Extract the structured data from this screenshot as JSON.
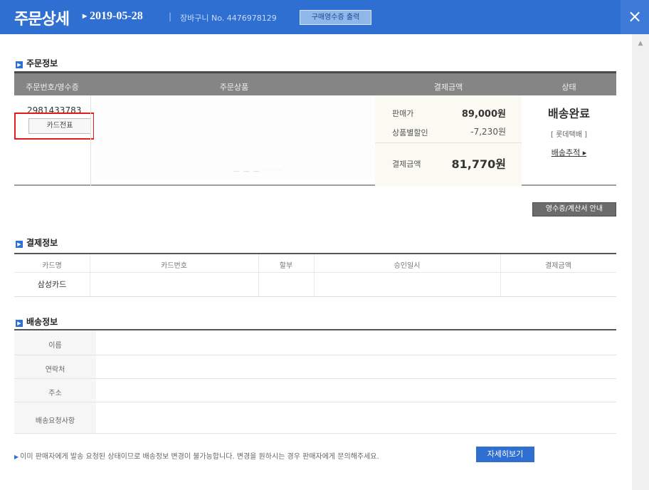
{
  "header": {
    "title": "주문상세",
    "date": "2019-05-28",
    "separator": "|",
    "cart_no": "장바구니 No. 4476978129",
    "print_button": "구매영수증 출력",
    "close_icon": "×"
  },
  "order_info": {
    "section_title": "주문정보",
    "columns": [
      "주문번호/영수증",
      "주문상품",
      "결제금액",
      "상태"
    ],
    "order_number": "2981433783",
    "card_slip_button": "카드전표",
    "payment": {
      "price_label": "판매가",
      "price_value": "89,000원",
      "discount_label": "상품별할인",
      "discount_value": "-7,230원",
      "total_label": "결제금액",
      "total_value": "81,770원"
    },
    "status": {
      "main": "배송완료",
      "courier": "[ 롯데택배 ]",
      "tracking_link": "배송추적 ▸"
    },
    "receipt_button": "영수증/계산서 안내"
  },
  "payment_info": {
    "section_title": "결제정보",
    "columns": [
      "카드명",
      "카드번호",
      "할부",
      "승인일시",
      "결제금액"
    ],
    "row": {
      "card_name": "삼성카드"
    }
  },
  "delivery_info": {
    "section_title": "배송정보",
    "labels": [
      "이름",
      "연락처",
      "주소",
      "배송요청사항"
    ]
  },
  "notice": {
    "text": "이미 판매자에게 발송 요청된 상태이므로 배송정보 변경이 불가능합니다. 변경을 원하시는 경우 판매자에게 문의해주세요.",
    "more_button": "자세히보기"
  },
  "colors": {
    "header_blue": "#2f6fd2",
    "highlight_red": "#e21b1b"
  }
}
